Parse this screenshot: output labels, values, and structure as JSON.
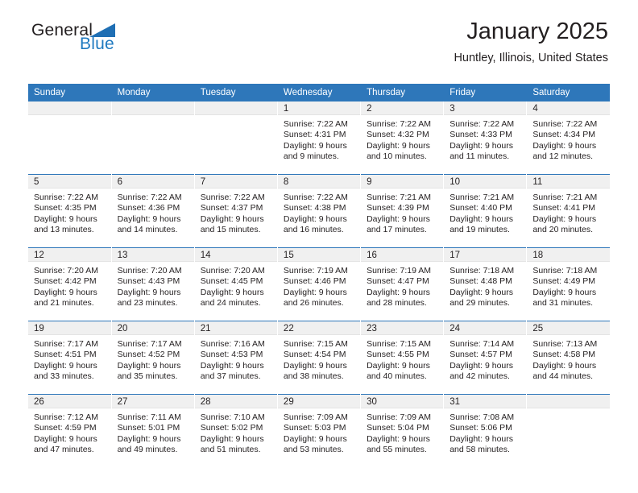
{
  "brand": {
    "name_part1": "General",
    "name_part2": "Blue",
    "triangle_color": "#1f6fb4",
    "blue_text_color": "#1f7ac0"
  },
  "header": {
    "title": "January 2025",
    "location": "Huntley, Illinois, United States"
  },
  "theme": {
    "header_bg": "#2e77ba",
    "header_text": "#ffffff",
    "daynum_band_bg": "#f0f0f0",
    "cell_bg": "#ffffff",
    "text": "#231f20"
  },
  "weekday_headers": [
    "Sunday",
    "Monday",
    "Tuesday",
    "Wednesday",
    "Thursday",
    "Friday",
    "Saturday"
  ],
  "weeks": [
    [
      {
        "day": "",
        "lines": []
      },
      {
        "day": "",
        "lines": []
      },
      {
        "day": "",
        "lines": []
      },
      {
        "day": "1",
        "lines": [
          "Sunrise: 7:22 AM",
          "Sunset: 4:31 PM",
          "Daylight: 9 hours",
          "and 9 minutes."
        ]
      },
      {
        "day": "2",
        "lines": [
          "Sunrise: 7:22 AM",
          "Sunset: 4:32 PM",
          "Daylight: 9 hours",
          "and 10 minutes."
        ]
      },
      {
        "day": "3",
        "lines": [
          "Sunrise: 7:22 AM",
          "Sunset: 4:33 PM",
          "Daylight: 9 hours",
          "and 11 minutes."
        ]
      },
      {
        "day": "4",
        "lines": [
          "Sunrise: 7:22 AM",
          "Sunset: 4:34 PM",
          "Daylight: 9 hours",
          "and 12 minutes."
        ]
      }
    ],
    [
      {
        "day": "5",
        "lines": [
          "Sunrise: 7:22 AM",
          "Sunset: 4:35 PM",
          "Daylight: 9 hours",
          "and 13 minutes."
        ]
      },
      {
        "day": "6",
        "lines": [
          "Sunrise: 7:22 AM",
          "Sunset: 4:36 PM",
          "Daylight: 9 hours",
          "and 14 minutes."
        ]
      },
      {
        "day": "7",
        "lines": [
          "Sunrise: 7:22 AM",
          "Sunset: 4:37 PM",
          "Daylight: 9 hours",
          "and 15 minutes."
        ]
      },
      {
        "day": "8",
        "lines": [
          "Sunrise: 7:22 AM",
          "Sunset: 4:38 PM",
          "Daylight: 9 hours",
          "and 16 minutes."
        ]
      },
      {
        "day": "9",
        "lines": [
          "Sunrise: 7:21 AM",
          "Sunset: 4:39 PM",
          "Daylight: 9 hours",
          "and 17 minutes."
        ]
      },
      {
        "day": "10",
        "lines": [
          "Sunrise: 7:21 AM",
          "Sunset: 4:40 PM",
          "Daylight: 9 hours",
          "and 19 minutes."
        ]
      },
      {
        "day": "11",
        "lines": [
          "Sunrise: 7:21 AM",
          "Sunset: 4:41 PM",
          "Daylight: 9 hours",
          "and 20 minutes."
        ]
      }
    ],
    [
      {
        "day": "12",
        "lines": [
          "Sunrise: 7:20 AM",
          "Sunset: 4:42 PM",
          "Daylight: 9 hours",
          "and 21 minutes."
        ]
      },
      {
        "day": "13",
        "lines": [
          "Sunrise: 7:20 AM",
          "Sunset: 4:43 PM",
          "Daylight: 9 hours",
          "and 23 minutes."
        ]
      },
      {
        "day": "14",
        "lines": [
          "Sunrise: 7:20 AM",
          "Sunset: 4:45 PM",
          "Daylight: 9 hours",
          "and 24 minutes."
        ]
      },
      {
        "day": "15",
        "lines": [
          "Sunrise: 7:19 AM",
          "Sunset: 4:46 PM",
          "Daylight: 9 hours",
          "and 26 minutes."
        ]
      },
      {
        "day": "16",
        "lines": [
          "Sunrise: 7:19 AM",
          "Sunset: 4:47 PM",
          "Daylight: 9 hours",
          "and 28 minutes."
        ]
      },
      {
        "day": "17",
        "lines": [
          "Sunrise: 7:18 AM",
          "Sunset: 4:48 PM",
          "Daylight: 9 hours",
          "and 29 minutes."
        ]
      },
      {
        "day": "18",
        "lines": [
          "Sunrise: 7:18 AM",
          "Sunset: 4:49 PM",
          "Daylight: 9 hours",
          "and 31 minutes."
        ]
      }
    ],
    [
      {
        "day": "19",
        "lines": [
          "Sunrise: 7:17 AM",
          "Sunset: 4:51 PM",
          "Daylight: 9 hours",
          "and 33 minutes."
        ]
      },
      {
        "day": "20",
        "lines": [
          "Sunrise: 7:17 AM",
          "Sunset: 4:52 PM",
          "Daylight: 9 hours",
          "and 35 minutes."
        ]
      },
      {
        "day": "21",
        "lines": [
          "Sunrise: 7:16 AM",
          "Sunset: 4:53 PM",
          "Daylight: 9 hours",
          "and 37 minutes."
        ]
      },
      {
        "day": "22",
        "lines": [
          "Sunrise: 7:15 AM",
          "Sunset: 4:54 PM",
          "Daylight: 9 hours",
          "and 38 minutes."
        ]
      },
      {
        "day": "23",
        "lines": [
          "Sunrise: 7:15 AM",
          "Sunset: 4:55 PM",
          "Daylight: 9 hours",
          "and 40 minutes."
        ]
      },
      {
        "day": "24",
        "lines": [
          "Sunrise: 7:14 AM",
          "Sunset: 4:57 PM",
          "Daylight: 9 hours",
          "and 42 minutes."
        ]
      },
      {
        "day": "25",
        "lines": [
          "Sunrise: 7:13 AM",
          "Sunset: 4:58 PM",
          "Daylight: 9 hours",
          "and 44 minutes."
        ]
      }
    ],
    [
      {
        "day": "26",
        "lines": [
          "Sunrise: 7:12 AM",
          "Sunset: 4:59 PM",
          "Daylight: 9 hours",
          "and 47 minutes."
        ]
      },
      {
        "day": "27",
        "lines": [
          "Sunrise: 7:11 AM",
          "Sunset: 5:01 PM",
          "Daylight: 9 hours",
          "and 49 minutes."
        ]
      },
      {
        "day": "28",
        "lines": [
          "Sunrise: 7:10 AM",
          "Sunset: 5:02 PM",
          "Daylight: 9 hours",
          "and 51 minutes."
        ]
      },
      {
        "day": "29",
        "lines": [
          "Sunrise: 7:09 AM",
          "Sunset: 5:03 PM",
          "Daylight: 9 hours",
          "and 53 minutes."
        ]
      },
      {
        "day": "30",
        "lines": [
          "Sunrise: 7:09 AM",
          "Sunset: 5:04 PM",
          "Daylight: 9 hours",
          "and 55 minutes."
        ]
      },
      {
        "day": "31",
        "lines": [
          "Sunrise: 7:08 AM",
          "Sunset: 5:06 PM",
          "Daylight: 9 hours",
          "and 58 minutes."
        ]
      },
      {
        "day": "",
        "lines": []
      }
    ]
  ]
}
